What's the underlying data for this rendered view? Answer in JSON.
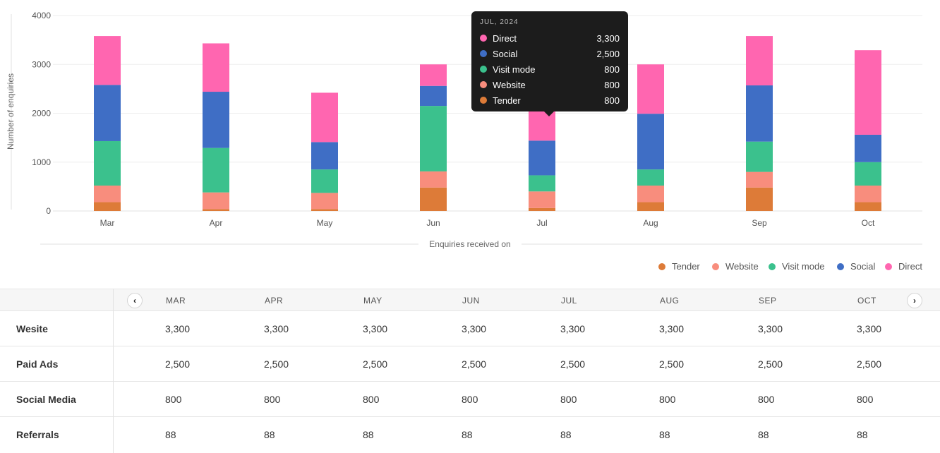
{
  "chart_data": {
    "type": "bar",
    "stacked": true,
    "categories": [
      "Mar",
      "Apr",
      "May",
      "Jun",
      "Jul",
      "Aug",
      "Sep",
      "Oct"
    ],
    "series": [
      {
        "name": "Tender",
        "color": "#dd7b38",
        "values": [
          180,
          40,
          40,
          480,
          60,
          180,
          480,
          180
        ]
      },
      {
        "name": "Website",
        "color": "#f88d7d",
        "values": [
          340,
          340,
          330,
          330,
          340,
          340,
          320,
          340
        ]
      },
      {
        "name": "Visit mode",
        "color": "#3bc18d",
        "values": [
          910,
          910,
          480,
          1340,
          330,
          330,
          620,
          480
        ]
      },
      {
        "name": "Social",
        "color": "#3f6ec5",
        "values": [
          1150,
          1150,
          560,
          410,
          710,
          1140,
          1150,
          560
        ]
      },
      {
        "name": "Direct",
        "color": "#ff66b0",
        "values": [
          1000,
          990,
          1010,
          440,
          790,
          1010,
          1010,
          1730
        ]
      }
    ],
    "ylim": [
      0,
      4000
    ],
    "yticks": [
      0,
      1000,
      2000,
      3000,
      4000
    ],
    "ylabel": "Number of enquiries",
    "xlabel": "Enquiries received on",
    "grid": true,
    "legend_position": "bottom-right",
    "legend": [
      "Tender",
      "Website",
      "Visit mode",
      "Social",
      "Direct"
    ]
  },
  "tooltip": {
    "title": "JUL, 2024",
    "rows": [
      {
        "name": "Direct",
        "value": "3,300",
        "color": "#ff66b0"
      },
      {
        "name": "Social",
        "value": "2,500",
        "color": "#3f6ec5"
      },
      {
        "name": "Visit mode",
        "value": "800",
        "color": "#3bc18d"
      },
      {
        "name": "Website",
        "value": "800",
        "color": "#f88d7d"
      },
      {
        "name": "Tender",
        "value": "800",
        "color": "#dd7b38"
      }
    ]
  },
  "table": {
    "prev_icon": "chevron-left-icon",
    "next_icon": "chevron-right-icon",
    "prev_glyph": "‹",
    "next_glyph": "›",
    "columns": [
      "MAR",
      "APR",
      "MAY",
      "JUN",
      "JUL",
      "AUG",
      "SEP",
      "OCT"
    ],
    "rows": [
      {
        "label": "Wesite",
        "values": [
          "3,300",
          "3,300",
          "3,300",
          "3,300",
          "3,300",
          "3,300",
          "3,300",
          "3,300"
        ]
      },
      {
        "label": "Paid Ads",
        "values": [
          "2,500",
          "2,500",
          "2,500",
          "2,500",
          "2,500",
          "2,500",
          "2,500",
          "2,500"
        ]
      },
      {
        "label": "Social Media",
        "values": [
          "800",
          "800",
          "800",
          "800",
          "800",
          "800",
          "800",
          "800"
        ]
      },
      {
        "label": "Referrals",
        "values": [
          "88",
          "88",
          "88",
          "88",
          "88",
          "88",
          "88",
          "88"
        ]
      }
    ]
  }
}
